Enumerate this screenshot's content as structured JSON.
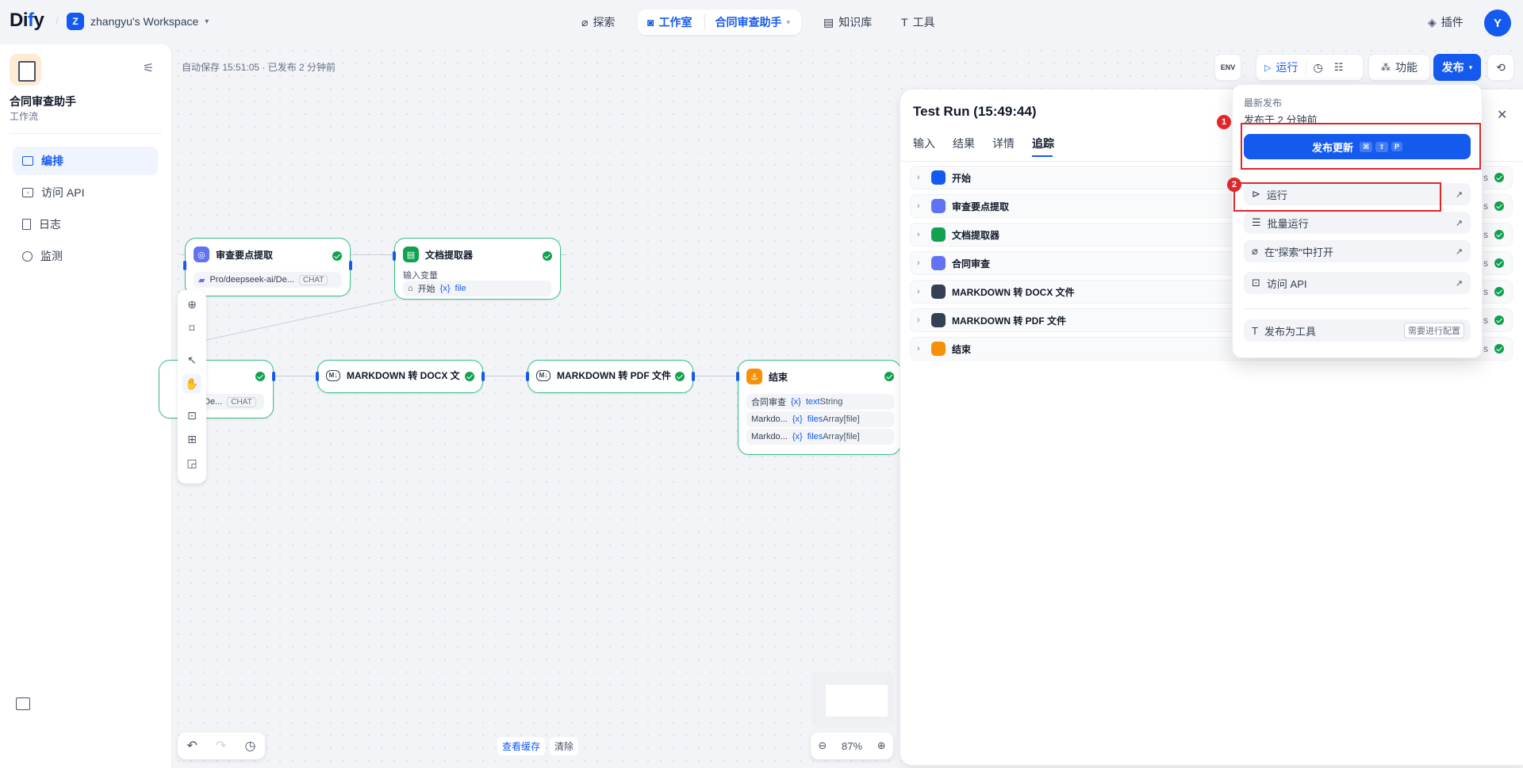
{
  "header": {
    "logo_prefix": "Di",
    "logo_y": "f",
    "logo_suffix": "y",
    "workspace_initial": "Z",
    "workspace_name": "zhangyu's Workspace",
    "nav": {
      "explore": "探索",
      "studio": "工作室",
      "current_app": "合同审查助手",
      "knowledge": "知识库",
      "tools": "工具",
      "plugins": "插件"
    },
    "avatar_initial": "Y"
  },
  "sidebar": {
    "app_name": "合同审查助手",
    "app_type": "工作流",
    "items": [
      {
        "label": "编排",
        "icon": "layout-icon",
        "active": true
      },
      {
        "label": "访问 API",
        "icon": "terminal-icon",
        "active": false
      },
      {
        "label": "日志",
        "icon": "file-text-icon",
        "active": false
      },
      {
        "label": "监测",
        "icon": "dashboard-icon",
        "active": false
      }
    ]
  },
  "toolbar": {
    "autosave": "自动保存 15:51:05 · 已发布 2 分钟前",
    "env_label": "ENV",
    "run_label": "运行",
    "feature_label": "功能",
    "publish_label": "发布"
  },
  "nodes": {
    "extract": {
      "title": "审查要点提取",
      "model": "Pro/deepseek-ai/De...",
      "mode": "CHAT"
    },
    "doc": {
      "title": "文档提取器",
      "input_label": "输入变量",
      "var_node": "开始",
      "var_name": "file"
    },
    "llm_left": {
      "model": "De...",
      "mode": "CHAT"
    },
    "docx": {
      "title": "MARKDOWN 转 DOCX 文"
    },
    "pdf": {
      "title": "MARKDOWN 转 PDF 文件"
    },
    "end": {
      "title": "结束",
      "outputs": [
        {
          "node": "合同审查",
          "var": "text",
          "type": "String"
        },
        {
          "node": "Markdo...",
          "var": "files",
          "type": "Array[file]"
        },
        {
          "node": "Markdo...",
          "var": "files",
          "type": "Array[file]"
        }
      ]
    }
  },
  "bottom": {
    "view_cache": "查看缓存",
    "clear": "清除",
    "zoom": "87%"
  },
  "test_run": {
    "title": "Test Run (15:49:44)",
    "tabs": [
      "输入",
      "结果",
      "详情",
      "追踪"
    ],
    "active_tab": "追踪",
    "rows": [
      {
        "label": "开始",
        "color": "#155aef",
        "tail": "s"
      },
      {
        "label": "审查要点提取",
        "color": "#6172f3",
        "tail": "s"
      },
      {
        "label": "文档提取器",
        "color": "#12a150",
        "tail": "s"
      },
      {
        "label": "合同审查",
        "color": "#6172f3",
        "tail": "s"
      },
      {
        "label": "MARKDOWN 转 DOCX 文件",
        "color": "#344054",
        "tail": "s"
      },
      {
        "label": "MARKDOWN 转 PDF 文件",
        "color": "#344054",
        "tail": "s"
      },
      {
        "label": "结束",
        "color": "#f79009",
        "tail": "s"
      }
    ]
  },
  "publish_menu": {
    "latest_label": "最新发布",
    "published_time": "发布于 2 分钟前",
    "update_button": "发布更新",
    "shortcut": [
      "⌘",
      "⇧",
      "P"
    ],
    "items": [
      {
        "label": "运行",
        "icon": "play-circle-icon"
      },
      {
        "label": "批量运行",
        "icon": "batch-run-icon"
      },
      {
        "label": "在\"探索\"中打开",
        "icon": "explore-icon"
      },
      {
        "label": "访问 API",
        "icon": "terminal-icon"
      }
    ],
    "publish_tool": "发布为工具",
    "needs_config": "需要进行配置"
  },
  "annotations": [
    "1",
    "2"
  ]
}
